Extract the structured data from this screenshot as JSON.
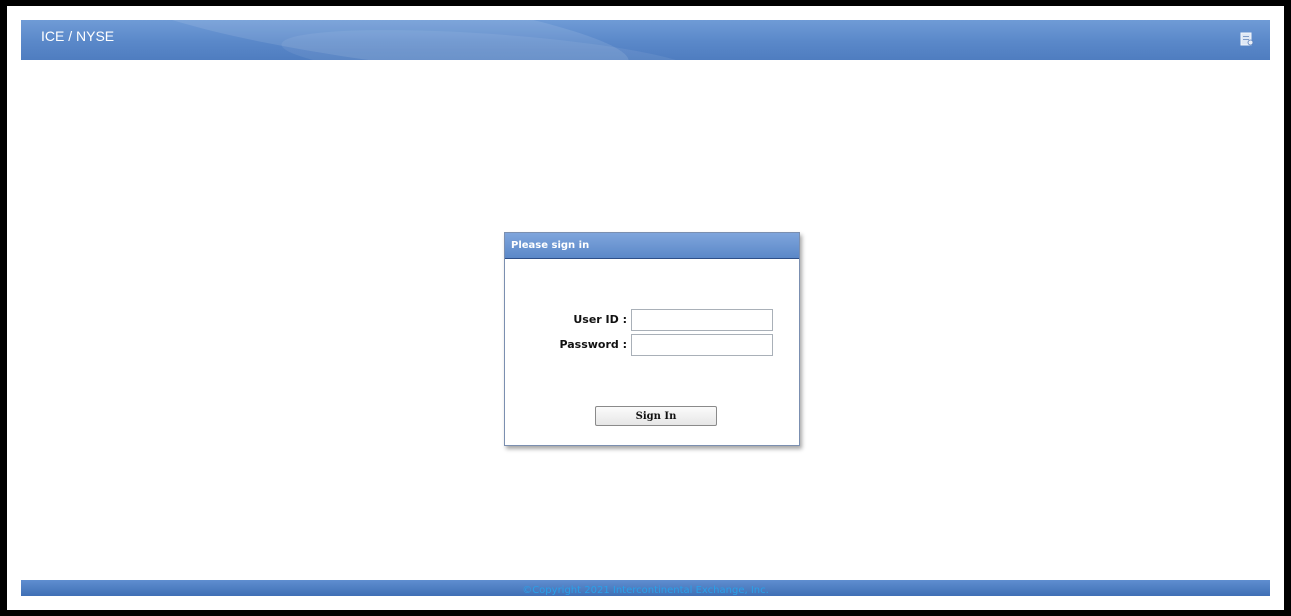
{
  "header": {
    "title": "ICE / NYSE",
    "icon": "page-icon"
  },
  "login": {
    "title": "Please sign in",
    "user_id_label": "User ID :",
    "user_id_value": "",
    "password_label": "Password :",
    "password_value": "",
    "submit_label": "Sign In"
  },
  "footer": {
    "copyright": "©Copyright 2021 Intercontinental Exchange, Inc."
  },
  "colors": {
    "header_blue": "#5a88c9",
    "footer_text": "#2aa0e8",
    "dialog_title": "#6b96d2"
  }
}
